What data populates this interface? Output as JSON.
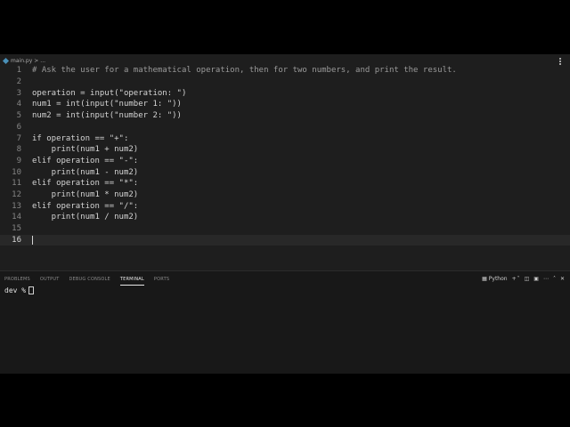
{
  "breadcrumb": {
    "file": "main.py",
    "separator": ">",
    "more": "..."
  },
  "editor": {
    "current_line": 16,
    "lines": [
      {
        "n": "1",
        "text": "# Ask the user for a mathematical operation, then for two numbers, and print the result.",
        "comment": true
      },
      {
        "n": "2",
        "text": ""
      },
      {
        "n": "3",
        "text": "operation = input(\"operation: \")"
      },
      {
        "n": "4",
        "text": "num1 = int(input(\"number 1: \"))"
      },
      {
        "n": "5",
        "text": "num2 = int(input(\"number 2: \"))"
      },
      {
        "n": "6",
        "text": ""
      },
      {
        "n": "7",
        "text": "if operation == \"+\":"
      },
      {
        "n": "8",
        "text": "    print(num1 + num2)"
      },
      {
        "n": "9",
        "text": "elif operation == \"-\":"
      },
      {
        "n": "10",
        "text": "    print(num1 - num2)"
      },
      {
        "n": "11",
        "text": "elif operation == \"*\":"
      },
      {
        "n": "12",
        "text": "    print(num1 * num2)"
      },
      {
        "n": "13",
        "text": "elif operation == \"/\":"
      },
      {
        "n": "14",
        "text": "    print(num1 / num2)"
      },
      {
        "n": "15",
        "text": ""
      },
      {
        "n": "16",
        "text": ""
      }
    ]
  },
  "panel": {
    "tabs": [
      "PROBLEMS",
      "OUTPUT",
      "DEBUG CONSOLE",
      "TERMINAL",
      "PORTS"
    ],
    "active_tab": "TERMINAL",
    "terminal_label": "Python",
    "terminal_prompt": "dev %"
  },
  "colors": {
    "background": "#1e1e1e",
    "panel": "#181818",
    "text": "#d4d4d4",
    "comment": "#9a9a9a"
  }
}
